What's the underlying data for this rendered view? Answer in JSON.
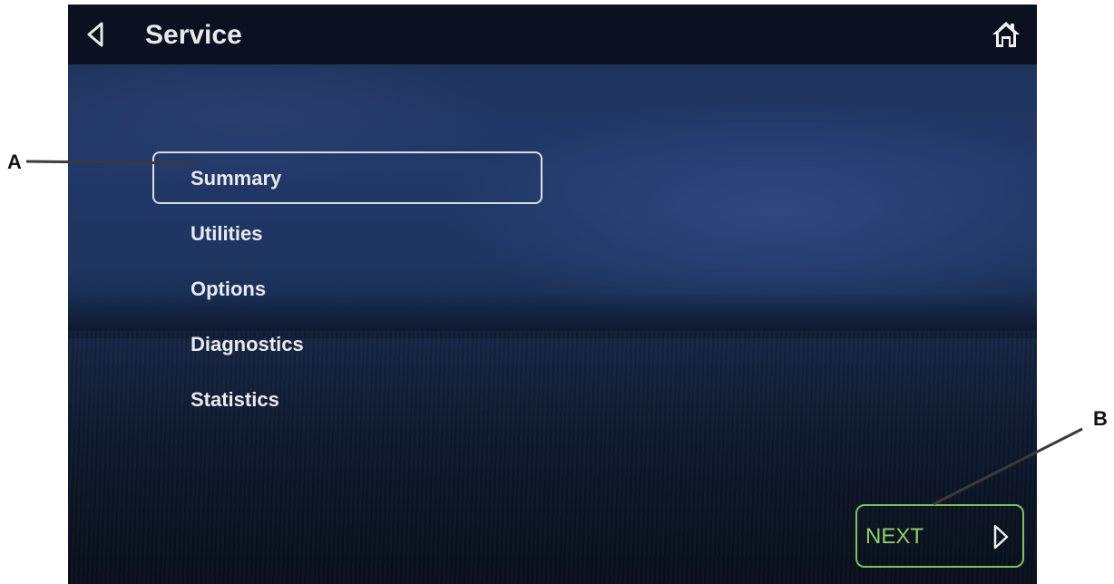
{
  "header": {
    "title": "Service",
    "back_icon": "chevron-left-icon",
    "home_icon": "home-icon"
  },
  "menu": {
    "selected_index": 0,
    "items": [
      {
        "label": "Summary"
      },
      {
        "label": "Utilities"
      },
      {
        "label": "Options"
      },
      {
        "label": "Diagnostics"
      },
      {
        "label": "Statistics"
      }
    ]
  },
  "next_button": {
    "label": "NEXT",
    "icon": "chevron-right-icon"
  },
  "callouts": {
    "a": "A",
    "b": "B"
  },
  "colors": {
    "accent_green": "#7fc35a",
    "header_bg": "#0b1120",
    "text": "#e8ebf0"
  }
}
